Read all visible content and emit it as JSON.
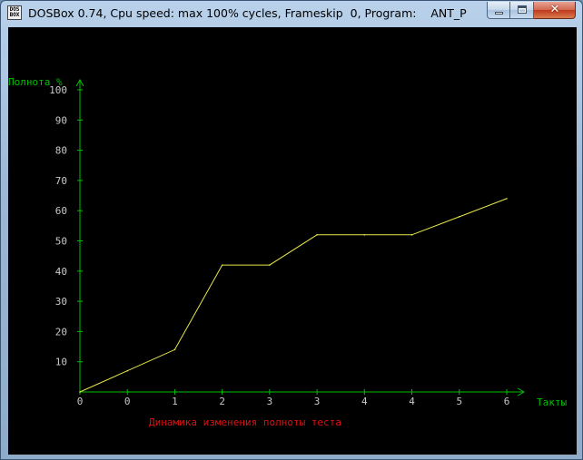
{
  "window": {
    "title": "DOSBox 0.74, Cpu speed: max 100% cycles, Frameskip  0, Program:    ANT_P",
    "icon_text_top": "DOS",
    "icon_text_bottom": "BOX",
    "close_glyph": "✕"
  },
  "colors": {
    "axis": "#00c000",
    "axis_label": "#00c000",
    "tick_label": "#c8c8c8",
    "series": "#e6e64a",
    "caption": "#e01010",
    "background": "#000000"
  },
  "chart_data": {
    "type": "line",
    "title": "",
    "caption": "Динамика изменения полноты теста",
    "ylabel": "Полнота %",
    "xlabel": "Такты",
    "ylim": [
      0,
      100
    ],
    "yticks": [
      "100",
      "90",
      "80",
      "70",
      "60",
      "50",
      "40",
      "30",
      "20",
      "10"
    ],
    "xtick_labels": [
      "0",
      "0",
      "1",
      "2",
      "3",
      "3",
      "4",
      "4",
      "5",
      "6"
    ],
    "grid": false,
    "legend": "none",
    "series": [
      {
        "x": [
          0,
          1,
          2,
          3,
          4,
          5,
          6,
          7,
          8,
          9
        ],
        "y": [
          0,
          7,
          14,
          42,
          42,
          52,
          52,
          52,
          58,
          64
        ]
      }
    ]
  }
}
